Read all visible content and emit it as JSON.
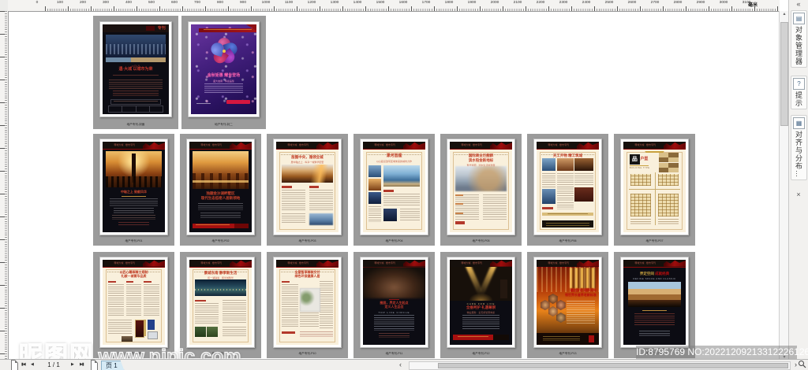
{
  "ruler": {
    "labels": [
      "0",
      "100",
      "200",
      "300",
      "400",
      "500",
      "600",
      "700",
      "800",
      "900",
      "1000",
      "1100",
      "1200",
      "1300",
      "1400",
      "1500",
      "1600",
      "1700",
      "1800",
      "1900",
      "2000",
      "2100",
      "2200",
      "2300",
      "2400",
      "2500",
      "2600",
      "2700",
      "2800",
      "2900",
      "3000",
      "3100"
    ],
    "unit": "毫米"
  },
  "dock": {
    "collapse": "«",
    "tabs": [
      {
        "label": "对象管理器"
      },
      {
        "label": "提示"
      },
      {
        "label": "对齐与分布…"
      }
    ],
    "close": "×"
  },
  "status": {
    "page_indicator": "1 / 1",
    "page_tab": "页 1"
  },
  "watermark": {
    "site": "昵图网",
    "url": "www.nipic.com",
    "id": "ID:8795769 NO:20221209213312226126"
  },
  "shared": {
    "masthead": "尊域大城 · 楼市专刊"
  },
  "pages": [
    {
      "caption": "地产专刊-封面",
      "header_label": "专刊",
      "date_line": "10月1日",
      "title": "遇·大城 以城市为荣"
    },
    {
      "caption": "地产专刊-封二",
      "headline": "金秋钜惠 耀世登场",
      "subline": "盛大启幕 · 恭迎品鉴"
    },
    {
      "caption": "地产专刊-P01",
      "headline": "中轴之上 致献风华"
    },
    {
      "caption": "地产专刊-P02",
      "headline1": "独踞金沙湖畔墅区",
      "headline2": "现代生态低密人居新领地"
    },
    {
      "caption": "地产专刊-P03",
      "headline": "版图中央，雅领全城",
      "subline": "居中轴之上 · 纵享一城繁华配套"
    },
    {
      "caption": "地产专刊-P04",
      "headline": "漯河首座",
      "subline": "以心起点改写区域未来的城市力作"
    },
    {
      "caption": "地产专刊-P05",
      "headline1": "国际商业巨舰群",
      "headline2": "滨水铂金新地标",
      "subline": "繁华商圈 · 滨水生活新封面"
    },
    {
      "caption": "地产专刊-P06",
      "headline": "天工开物 精工筑城"
    },
    {
      "caption": "地产专刊-P07",
      "logo": "品",
      "logo_sub": "户型",
      "note": "BUILDING TYPE"
    },
    {
      "caption": "地产专刊-P08",
      "headline1": "以匠心雕琢精工规制",
      "headline2": "礼献一城菁华品质"
    },
    {
      "caption": "地产专刊-P09",
      "headline": "景城东南 静享新生活",
      "subline": "揽一湖静谧 · 阅半城繁华"
    },
    {
      "caption": "地产专刊-P10",
      "headline1": "全屋智享精装交付",
      "headline2": "绿色环保健康人居"
    },
    {
      "caption": "地产专刊-P11",
      "headline1": "圈层，界定人生起点",
      "headline2": "定义人生品位",
      "eyebrow": "TOP LIFE CIRCLE"
    },
    {
      "caption": "地产专刊-P12",
      "eyebrow": "CARE FOR LIFE",
      "headline": "全维呵护 礼遇尊崇",
      "subline": "物业服务 · 全天候管家体系"
    },
    {
      "caption": "地产专刊-P13",
      "headline1": "鎏金岁月 颐养天年",
      "headline2": "领世界长者养老新标准"
    },
    {
      "caption": "地产专刊-P14",
      "headline_gold": "界定空间",
      "headline_red": "成就经典",
      "eyebrow": "DEFINE SPACE AND CLASSIC"
    }
  ]
}
